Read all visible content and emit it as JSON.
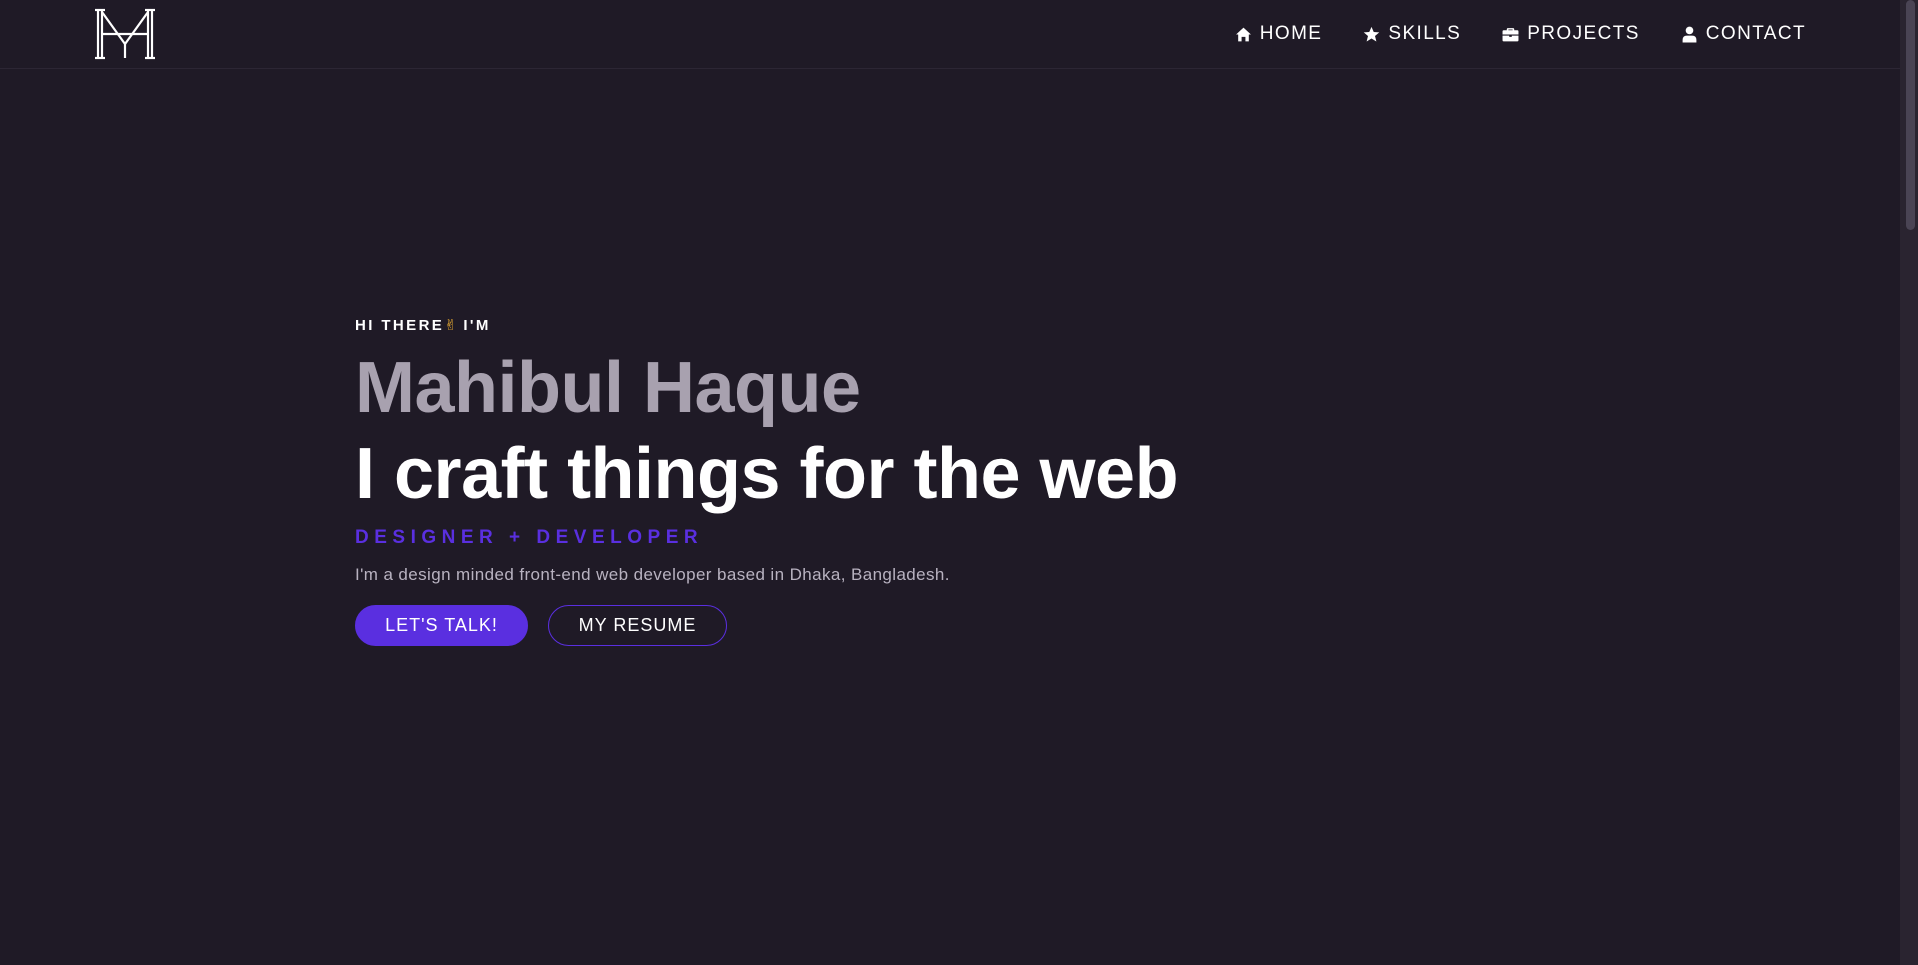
{
  "nav": {
    "logo_alt": "MH",
    "items": [
      {
        "label": "HOME",
        "icon": "home-icon"
      },
      {
        "label": "SKILLS",
        "icon": "star-icon"
      },
      {
        "label": "PROJECTS",
        "icon": "briefcase-icon"
      },
      {
        "label": "CONTACT",
        "icon": "user-icon"
      }
    ]
  },
  "hero": {
    "greeting_prefix": "HI THERE",
    "greeting_emoji": "✌",
    "greeting_suffix": " I'M",
    "name": "Mahibul Haque",
    "tagline": "I craft things for the web",
    "roles": "DESIGNER + DEVELOPER",
    "bio": "I'm a design minded front-end web developer based in Dhaka, Bangladesh.",
    "primary_cta": "LET'S TALK!",
    "secondary_cta": "MY RESUME"
  },
  "colors": {
    "background": "#1f1a26",
    "accent": "#5a2fe0",
    "name_text": "#a8a1af",
    "body_text": "#b8b2c0",
    "emoji": "#f2b233"
  }
}
